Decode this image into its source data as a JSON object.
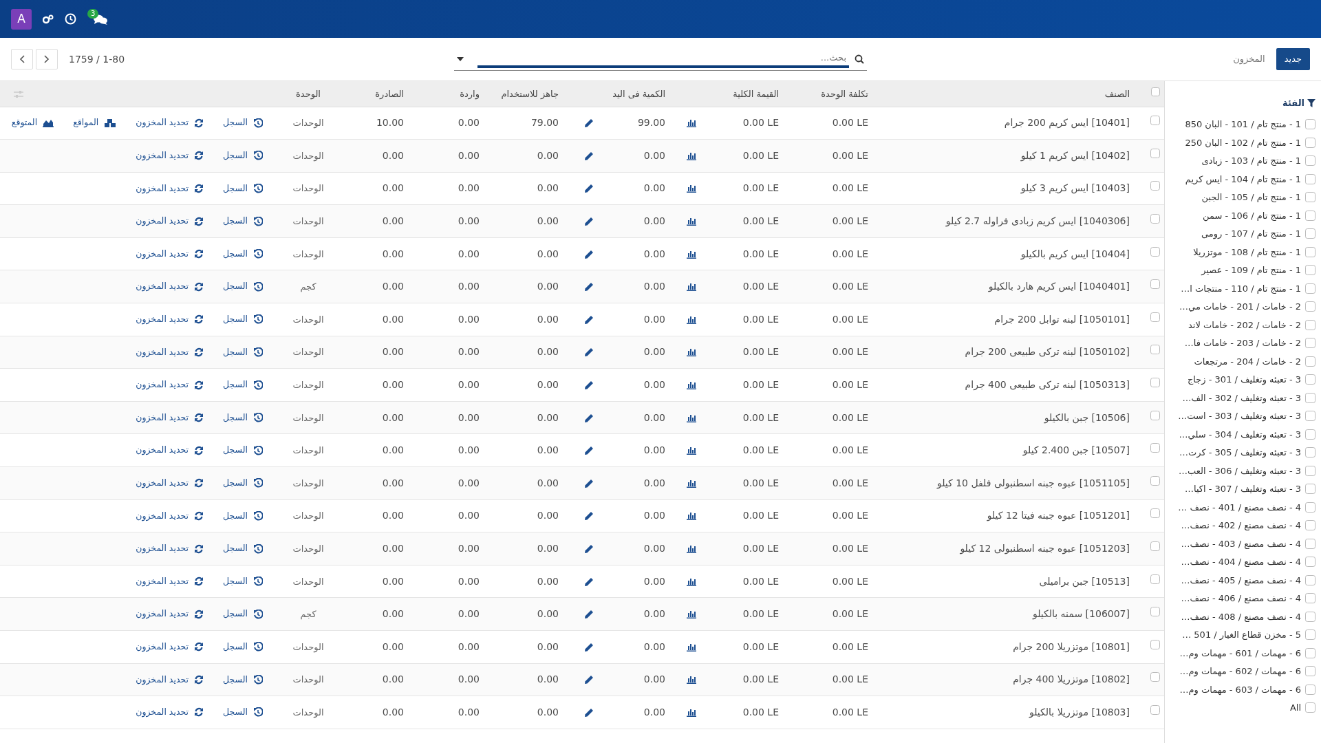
{
  "navbar": {
    "avatar": "A",
    "chat_badge": "3"
  },
  "control_panel": {
    "new_button": "جديد",
    "breadcrumb": "المخزون",
    "search": {
      "placeholder": "بحث..."
    },
    "pager": "1-80 / 1759"
  },
  "table": {
    "all_selected": false,
    "columns": [
      "الصنف",
      "تكلفة الوحدة",
      "القيمة الكلية",
      "الكمية فى اليد",
      "جاهز للاستخدام",
      "واردة",
      "الصادرة",
      "الوحدة"
    ],
    "rows": [
      {
        "selected": false,
        "product": "[10401] ايس كريم 200 جرام",
        "unit_cost": "0.00 LE",
        "total_value": "0.00 LE",
        "on_hand": "99.00",
        "ready": "79.00",
        "incoming": "0.00",
        "outgoing": "10.00",
        "unit": "الوحدات",
        "actions": [
          {
            "kind": "history",
            "label": "السجل"
          },
          {
            "kind": "refresh",
            "label": "تحديد المخزون"
          },
          {
            "kind": "locations",
            "label": "المواقع"
          },
          {
            "kind": "forecast",
            "label": "المتوقع"
          }
        ]
      },
      {
        "selected": false,
        "product": "[10402] ايس كريم 1 كيلو",
        "unit_cost": "0.00 LE",
        "total_value": "0.00 LE",
        "on_hand": "0.00",
        "ready": "0.00",
        "incoming": "0.00",
        "outgoing": "0.00",
        "unit": "الوحدات",
        "actions": [
          {
            "kind": "history",
            "label": "السجل"
          },
          {
            "kind": "refresh",
            "label": "تحديد المخزون"
          }
        ]
      },
      {
        "selected": false,
        "product": "[10403] ايس كريم 3 كيلو",
        "unit_cost": "0.00 LE",
        "total_value": "0.00 LE",
        "on_hand": "0.00",
        "ready": "0.00",
        "incoming": "0.00",
        "outgoing": "0.00",
        "unit": "الوحدات",
        "actions": [
          {
            "kind": "history",
            "label": "السجل"
          },
          {
            "kind": "refresh",
            "label": "تحديد المخزون"
          }
        ]
      },
      {
        "selected": false,
        "product": "[1040306] ايس كريم زبادى فراوله 2.7 كيلو",
        "unit_cost": "0.00 LE",
        "total_value": "0.00 LE",
        "on_hand": "0.00",
        "ready": "0.00",
        "incoming": "0.00",
        "outgoing": "0.00",
        "unit": "الوحدات",
        "actions": [
          {
            "kind": "history",
            "label": "السجل"
          },
          {
            "kind": "refresh",
            "label": "تحديد المخزون"
          }
        ]
      },
      {
        "selected": false,
        "product": "[10404] ايس كريم بالكيلو",
        "unit_cost": "0.00 LE",
        "total_value": "0.00 LE",
        "on_hand": "0.00",
        "ready": "0.00",
        "incoming": "0.00",
        "outgoing": "0.00",
        "unit": "الوحدات",
        "actions": [
          {
            "kind": "history",
            "label": "السجل"
          },
          {
            "kind": "refresh",
            "label": "تحديد المخزون"
          }
        ]
      },
      {
        "selected": false,
        "product": "[1040401] ايس كريم هارد بالكيلو",
        "unit_cost": "0.00 LE",
        "total_value": "0.00 LE",
        "on_hand": "0.00",
        "ready": "0.00",
        "incoming": "0.00",
        "outgoing": "0.00",
        "unit": "كجم",
        "actions": [
          {
            "kind": "history",
            "label": "السجل"
          },
          {
            "kind": "refresh",
            "label": "تحديد المخزون"
          }
        ]
      },
      {
        "selected": false,
        "product": "[1050101] لبنه توابل 200 جرام",
        "unit_cost": "0.00 LE",
        "total_value": "0.00 LE",
        "on_hand": "0.00",
        "ready": "0.00",
        "incoming": "0.00",
        "outgoing": "0.00",
        "unit": "الوحدات",
        "actions": [
          {
            "kind": "history",
            "label": "السجل"
          },
          {
            "kind": "refresh",
            "label": "تحديد المخزون"
          }
        ]
      },
      {
        "selected": false,
        "product": "[1050102] لبنه تركى طبيعى 200 جرام",
        "unit_cost": "0.00 LE",
        "total_value": "0.00 LE",
        "on_hand": "0.00",
        "ready": "0.00",
        "incoming": "0.00",
        "outgoing": "0.00",
        "unit": "الوحدات",
        "actions": [
          {
            "kind": "history",
            "label": "السجل"
          },
          {
            "kind": "refresh",
            "label": "تحديد المخزون"
          }
        ]
      },
      {
        "selected": false,
        "product": "[1050313] لبنه تركى طبيعى 400 جرام",
        "unit_cost": "0.00 LE",
        "total_value": "0.00 LE",
        "on_hand": "0.00",
        "ready": "0.00",
        "incoming": "0.00",
        "outgoing": "0.00",
        "unit": "الوحدات",
        "actions": [
          {
            "kind": "history",
            "label": "السجل"
          },
          {
            "kind": "refresh",
            "label": "تحديد المخزون"
          }
        ]
      },
      {
        "selected": false,
        "product": "[10506] جبن بالكيلو",
        "unit_cost": "0.00 LE",
        "total_value": "0.00 LE",
        "on_hand": "0.00",
        "ready": "0.00",
        "incoming": "0.00",
        "outgoing": "0.00",
        "unit": "الوحدات",
        "actions": [
          {
            "kind": "history",
            "label": "السجل"
          },
          {
            "kind": "refresh",
            "label": "تحديد المخزون"
          }
        ]
      },
      {
        "selected": false,
        "product": "[10507] جبن 2.400 كيلو",
        "unit_cost": "0.00 LE",
        "total_value": "0.00 LE",
        "on_hand": "0.00",
        "ready": "0.00",
        "incoming": "0.00",
        "outgoing": "0.00",
        "unit": "الوحدات",
        "actions": [
          {
            "kind": "history",
            "label": "السجل"
          },
          {
            "kind": "refresh",
            "label": "تحديد المخزون"
          }
        ]
      },
      {
        "selected": false,
        "product": "[1051105] عبوه جبنه اسطنبولى فلفل 10 كيلو",
        "unit_cost": "0.00 LE",
        "total_value": "0.00 LE",
        "on_hand": "0.00",
        "ready": "0.00",
        "incoming": "0.00",
        "outgoing": "0.00",
        "unit": "الوحدات",
        "actions": [
          {
            "kind": "history",
            "label": "السجل"
          },
          {
            "kind": "refresh",
            "label": "تحديد المخزون"
          }
        ]
      },
      {
        "selected": false,
        "product": "[1051201] عبوه جبنه فيتا 12 كيلو",
        "unit_cost": "0.00 LE",
        "total_value": "0.00 LE",
        "on_hand": "0.00",
        "ready": "0.00",
        "incoming": "0.00",
        "outgoing": "0.00",
        "unit": "الوحدات",
        "actions": [
          {
            "kind": "history",
            "label": "السجل"
          },
          {
            "kind": "refresh",
            "label": "تحديد المخزون"
          }
        ]
      },
      {
        "selected": false,
        "product": "[1051203] عبوه جبنه اسطنبولى 12 كيلو",
        "unit_cost": "0.00 LE",
        "total_value": "0.00 LE",
        "on_hand": "0.00",
        "ready": "0.00",
        "incoming": "0.00",
        "outgoing": "0.00",
        "unit": "الوحدات",
        "actions": [
          {
            "kind": "history",
            "label": "السجل"
          },
          {
            "kind": "refresh",
            "label": "تحديد المخزون"
          }
        ]
      },
      {
        "selected": false,
        "product": "[10513] جبن براميلى",
        "unit_cost": "0.00 LE",
        "total_value": "0.00 LE",
        "on_hand": "0.00",
        "ready": "0.00",
        "incoming": "0.00",
        "outgoing": "0.00",
        "unit": "الوحدات",
        "actions": [
          {
            "kind": "history",
            "label": "السجل"
          },
          {
            "kind": "refresh",
            "label": "تحديد المخزون"
          }
        ]
      },
      {
        "selected": false,
        "product": "[106007] سمنه بالكيلو",
        "unit_cost": "0.00 LE",
        "total_value": "0.00 LE",
        "on_hand": "0.00",
        "ready": "0.00",
        "incoming": "0.00",
        "outgoing": "0.00",
        "unit": "كجم",
        "actions": [
          {
            "kind": "history",
            "label": "السجل"
          },
          {
            "kind": "refresh",
            "label": "تحديد المخزون"
          }
        ]
      },
      {
        "selected": false,
        "product": "[10801] موتزريلا 200 جرام",
        "unit_cost": "0.00 LE",
        "total_value": "0.00 LE",
        "on_hand": "0.00",
        "ready": "0.00",
        "incoming": "0.00",
        "outgoing": "0.00",
        "unit": "الوحدات",
        "actions": [
          {
            "kind": "history",
            "label": "السجل"
          },
          {
            "kind": "refresh",
            "label": "تحديد المخزون"
          }
        ]
      },
      {
        "selected": false,
        "product": "[10802] موتزريلا 400 جرام",
        "unit_cost": "0.00 LE",
        "total_value": "0.00 LE",
        "on_hand": "0.00",
        "ready": "0.00",
        "incoming": "0.00",
        "outgoing": "0.00",
        "unit": "الوحدات",
        "actions": [
          {
            "kind": "history",
            "label": "السجل"
          },
          {
            "kind": "refresh",
            "label": "تحديد المخزون"
          }
        ]
      },
      {
        "selected": false,
        "product": "[10803] موتزريلا بالكيلو",
        "unit_cost": "0.00 LE",
        "total_value": "0.00 LE",
        "on_hand": "0.00",
        "ready": "0.00",
        "incoming": "0.00",
        "outgoing": "0.00",
        "unit": "الوحدات",
        "actions": [
          {
            "kind": "history",
            "label": "السجل"
          },
          {
            "kind": "refresh",
            "label": "تحديد المخزون"
          }
        ]
      }
    ]
  },
  "sidebar": {
    "title": "الفئة",
    "items": [
      {
        "label": "1 - منتج تام / 101 - البان 850",
        "checked": false
      },
      {
        "label": "1 - منتج تام / 102 - البان 250",
        "checked": false
      },
      {
        "label": "1 - منتج تام / 103 - زبادى",
        "checked": false
      },
      {
        "label": "1 - منتج تام / 104 - ايس كريم",
        "checked": false
      },
      {
        "label": "1 - منتج تام / 105 - الجبن",
        "checked": false
      },
      {
        "label": "1 - منتج تام / 106 - سمن",
        "checked": false
      },
      {
        "label": "1 - منتج تام / 107 - رومى",
        "checked": false
      },
      {
        "label": "1 - منتج تام / 108 - موتزريلا",
        "checked": false
      },
      {
        "label": "1 - منتج تام / 109 - عصير",
        "checked": false
      },
      {
        "label": "1 - منتج تام / 110 - منتجات ا…",
        "checked": false
      },
      {
        "label": "2 - خامات / 201 - خامات مي…",
        "checked": false
      },
      {
        "label": "2 - خامات / 202 - خامات لاند",
        "checked": false
      },
      {
        "label": "2 - خامات / 203 - خامات فا…",
        "checked": false
      },
      {
        "label": "2 - خامات / 204 - مرتجعات",
        "checked": false
      },
      {
        "label": "3 - تعبئه وتغليف / 301 - زجاج",
        "checked": false
      },
      {
        "label": "3 - تعبئه وتغليف / 302 - الف…",
        "checked": false
      },
      {
        "label": "3 - تعبئه وتغليف / 303 - است…",
        "checked": false
      },
      {
        "label": "3 - تعبئه وتغليف / 304 - سلي…",
        "checked": false
      },
      {
        "label": "3 - تعبئه وتغليف / 305 - كرت…",
        "checked": false
      },
      {
        "label": "3 - تعبئه وتغليف / 306 - العب…",
        "checked": false
      },
      {
        "label": "3 - تعبئه وتغليف / 307 - اكيا…",
        "checked": false
      },
      {
        "label": "4 - نصف مصنع / 401 - نصف …",
        "checked": false
      },
      {
        "label": "4 - نصف مصنع / 402 - نصف…",
        "checked": false
      },
      {
        "label": "4 - نصف مصنع / 403 - نصف…",
        "checked": false
      },
      {
        "label": "4 - نصف مصنع / 404 - نصف…",
        "checked": false
      },
      {
        "label": "4 - نصف مصنع / 405 - نصف…",
        "checked": false
      },
      {
        "label": "4 - نصف مصنع / 406 - نصف…",
        "checked": false
      },
      {
        "label": "4 - نصف مصنع / 408 - نصف…",
        "checked": false
      },
      {
        "label": "5 - مخزن قطاع الغيار / 501 …",
        "checked": false
      },
      {
        "label": "6 - مهمات / 601 - مهمات وم…",
        "checked": false
      },
      {
        "label": "6 - مهمات / 602 - مهمات وم…",
        "checked": false
      },
      {
        "label": "6 - مهمات / 603 - مهمات وم…",
        "checked": false
      },
      {
        "label": "All",
        "checked": false
      }
    ]
  }
}
